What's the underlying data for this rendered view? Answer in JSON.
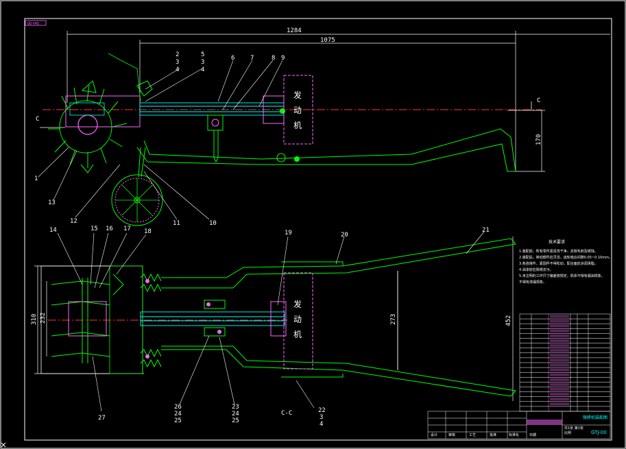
{
  "drawing": {
    "tag_label": "00-Y45",
    "section_marker": "C",
    "section_view_label": "C-C",
    "engine_label_chars": [
      "发",
      "动",
      "机"
    ]
  },
  "dimensions": {
    "overall_length": "1284",
    "engine_to_handle": "1075",
    "handle_height": "170",
    "frame_width": "310",
    "tine_width": "232",
    "inner_width": "273",
    "handle_span": "452"
  },
  "callouts": [
    {
      "id": "c1",
      "text": "1"
    },
    {
      "id": "c2",
      "text": "2"
    },
    {
      "id": "c3",
      "text": "3"
    },
    {
      "id": "c4",
      "text": "4"
    },
    {
      "id": "c5",
      "text": "5"
    },
    {
      "id": "c3b",
      "text": "3"
    },
    {
      "id": "c4b",
      "text": "4"
    },
    {
      "id": "c6",
      "text": "6"
    },
    {
      "id": "c7",
      "text": "7"
    },
    {
      "id": "c8",
      "text": "8"
    },
    {
      "id": "c9",
      "text": "9"
    },
    {
      "id": "c10",
      "text": "10"
    },
    {
      "id": "c11",
      "text": "11"
    },
    {
      "id": "c12",
      "text": "12"
    },
    {
      "id": "c13",
      "text": "13"
    },
    {
      "id": "c14",
      "text": "14"
    },
    {
      "id": "c15",
      "text": "15"
    },
    {
      "id": "c16",
      "text": "16"
    },
    {
      "id": "c17",
      "text": "17"
    },
    {
      "id": "c18",
      "text": "18"
    },
    {
      "id": "c19",
      "text": "19"
    },
    {
      "id": "c20",
      "text": "20"
    },
    {
      "id": "c21",
      "text": "21"
    },
    {
      "id": "c22",
      "text": "22"
    },
    {
      "id": "c3c",
      "text": "3"
    },
    {
      "id": "c4c",
      "text": "4"
    },
    {
      "id": "c23",
      "text": "23"
    },
    {
      "id": "c24",
      "text": "24"
    },
    {
      "id": "c25",
      "text": "25"
    },
    {
      "id": "c26",
      "text": "26"
    },
    {
      "id": "c24b",
      "text": "24"
    },
    {
      "id": "c25b",
      "text": "25"
    },
    {
      "id": "c27",
      "text": "27"
    }
  ],
  "tech_notes": {
    "title": "技术要求",
    "lines": [
      "1.装配前，所有零件需清洗干净，去除毛刺及锈蚀。",
      "2.装配后，转动部件应灵活，齿轮啮合间隙0.05~0.10mm。",
      "3.各连接件，紧固件不得松动，配合面应涂润滑脂。",
      "4.油漆前应除锈去污。",
      "5.未注明的工作尺寸偏差按规定，机体不得有漏油现象。",
      "不得有渗漏现象。"
    ]
  },
  "title_block": {
    "name": "微耕机装配图",
    "code": "GTJ-00",
    "scale_note": "比例",
    "sheet_note": "共1张 第1张",
    "cells": [
      "设计",
      "审核",
      "工艺",
      "批准",
      "标准化",
      "日期"
    ]
  }
}
